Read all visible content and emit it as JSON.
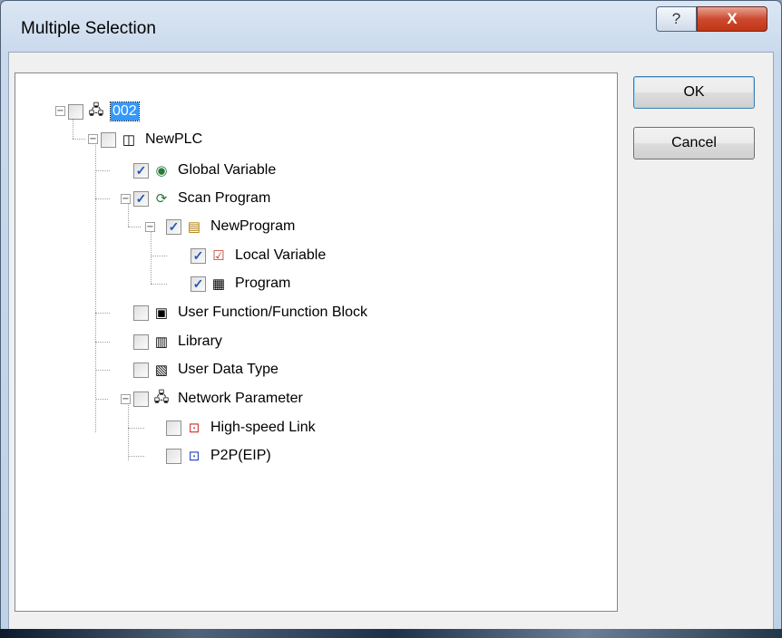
{
  "window": {
    "title": "Multiple Selection",
    "help_symbol": "?",
    "close_symbol": "X"
  },
  "buttons": {
    "ok": "OK",
    "cancel": "Cancel"
  },
  "tree": {
    "root": {
      "label": "002",
      "checked": false,
      "expanded": true,
      "icon": "network-station-icon"
    },
    "plc": {
      "label": "NewPLC",
      "checked": false,
      "expanded": true,
      "icon": "plc-cube-icon"
    },
    "global_variable": {
      "label": "Global Variable",
      "checked": true,
      "icon": "global-variable-icon"
    },
    "scan_program": {
      "label": "Scan Program",
      "checked": true,
      "expanded": true,
      "icon": "scan-program-icon"
    },
    "new_program": {
      "label": "NewProgram",
      "checked": true,
      "expanded": true,
      "icon": "program-block-icon"
    },
    "local_variable": {
      "label": "Local Variable",
      "checked": true,
      "icon": "local-variable-icon"
    },
    "program": {
      "label": "Program",
      "checked": true,
      "icon": "program-icon"
    },
    "user_function": {
      "label": "User Function/Function Block",
      "checked": false,
      "icon": "user-function-icon"
    },
    "library": {
      "label": "Library",
      "checked": false,
      "icon": "library-icon"
    },
    "user_data_type": {
      "label": "User Data Type",
      "checked": false,
      "icon": "user-data-type-icon"
    },
    "network_parameter": {
      "label": "Network Parameter",
      "checked": false,
      "expanded": true,
      "icon": "network-parameter-icon"
    },
    "high_speed_link": {
      "label": "High-speed Link",
      "checked": false,
      "icon": "high-speed-link-icon"
    },
    "p2p": {
      "label": "P2P(EIP)",
      "checked": false,
      "icon": "p2p-icon"
    }
  }
}
